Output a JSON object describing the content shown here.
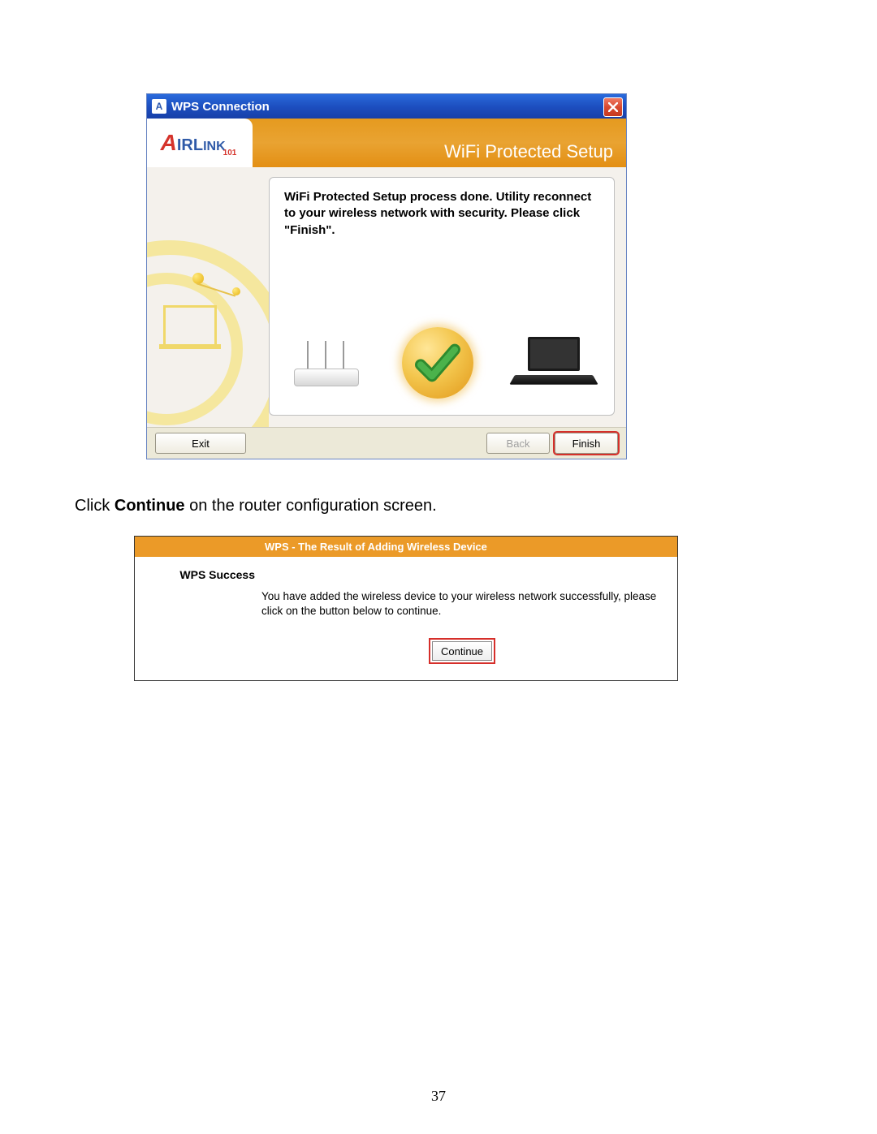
{
  "wps_dialog": {
    "title": "WPS Connection",
    "logo_name": "AirLink 101",
    "header_title": "WiFi Protected Setup",
    "message": "WiFi Protected Setup process done. Utility reconnect to your wireless network with security. Please click \"Finish\".",
    "buttons": {
      "exit": "Exit",
      "back": "Back",
      "finish": "Finish"
    },
    "icons": {
      "router": "router-icon",
      "success": "success-check-icon",
      "laptop": "laptop-icon"
    }
  },
  "instruction": {
    "prefix": "Click ",
    "bold": "Continue",
    "suffix": " on the router configuration screen."
  },
  "result_panel": {
    "header": "WPS - The Result of Adding Wireless Device",
    "left_label": "WPS Success",
    "body_text": "You have added the wireless device to your wireless network successfully, please click on the button below to continue.",
    "continue_label": "Continue"
  },
  "page_number": "37",
  "colors": {
    "titlebar": "#1d4fc0",
    "orange_header": "#e59a1f",
    "highlight_red": "#d62f2a",
    "result_header": "#eb9a28"
  }
}
